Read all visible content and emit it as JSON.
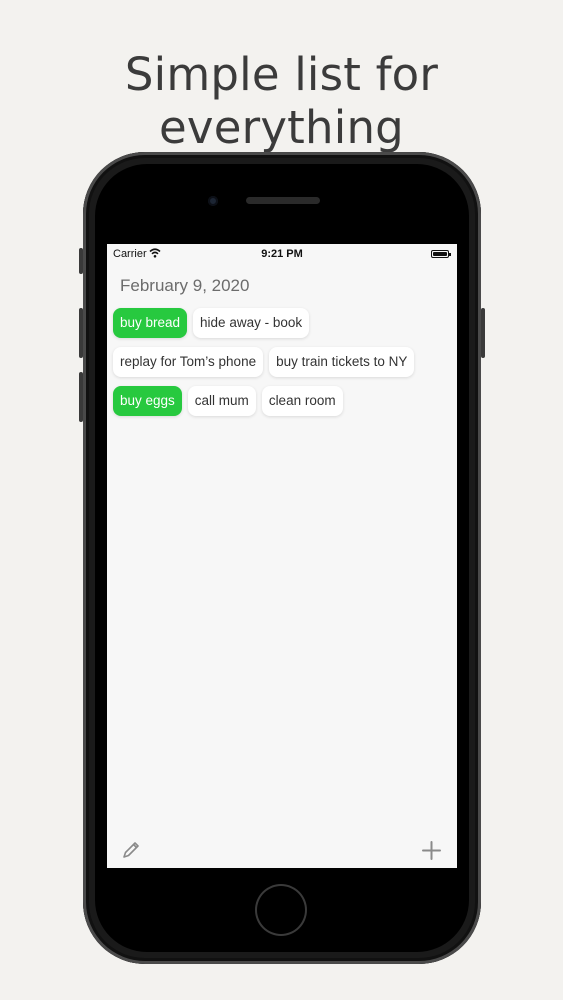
{
  "headline": "Simple list for everything",
  "status_bar": {
    "carrier": "Carrier",
    "time": "9:21 PM"
  },
  "date": "February 9, 2020",
  "rows": [
    [
      {
        "label": "buy bread",
        "done": true
      },
      {
        "label": "hide away - book",
        "done": false
      }
    ],
    [
      {
        "label": "replay for Tom’s phone",
        "done": false
      },
      {
        "label": "buy train tickets to NY",
        "done": false
      }
    ],
    [
      {
        "label": "buy eggs",
        "done": true
      },
      {
        "label": "call mum",
        "done": false
      },
      {
        "label": "clean room",
        "done": false
      }
    ]
  ],
  "toolbar": {
    "edit_icon": "pencil-icon",
    "add_icon": "plus-icon"
  },
  "colors": {
    "done_chip": "#27c93f",
    "background": "#f3f2ef",
    "screen": "#f7f7f7"
  }
}
